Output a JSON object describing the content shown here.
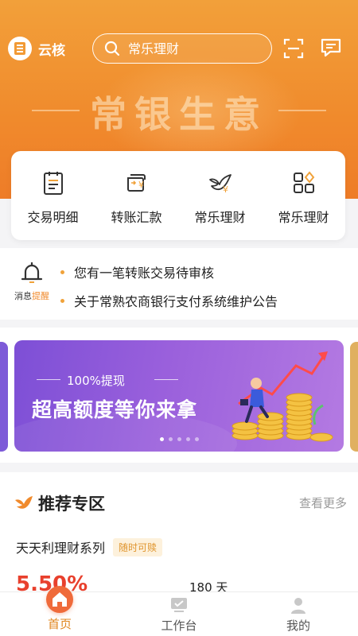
{
  "header": {
    "brand": "云核",
    "search_placeholder": "常乐理财",
    "slogan": "常银生意"
  },
  "quick_actions": [
    {
      "label": "交易明细",
      "icon": "clipboard-icon"
    },
    {
      "label": "转账汇款",
      "icon": "transfer-card-icon"
    },
    {
      "label": "常乐理财",
      "icon": "bird-yuan-icon"
    },
    {
      "label": "常乐理财",
      "icon": "grid-diamond-icon"
    }
  ],
  "notice": {
    "tag_prefix": "消息",
    "tag_highlight": "提醒",
    "items": [
      "您有一笔转账交易待审核",
      "关于常熟农商银行支付系统维护公告"
    ]
  },
  "banner": {
    "subtitle": "100%提现",
    "title": "超高额度等你来拿",
    "dots": 5,
    "active_dot": 0
  },
  "recommend": {
    "title": "推荐专区",
    "more": "查看更多",
    "product_name": "天天利理财系列",
    "product_tag": "随时可赎",
    "rate": "5.50%",
    "days": "180 天"
  },
  "tabbar": [
    {
      "label": "首页",
      "icon": "home-icon",
      "active": true
    },
    {
      "label": "工作台",
      "icon": "monitor-icon",
      "active": false
    },
    {
      "label": "我的",
      "icon": "user-icon",
      "active": false
    }
  ],
  "colors": {
    "accent": "#f08a2c",
    "rate_red": "#e8402d",
    "banner_purple": "#7d4fd6"
  }
}
